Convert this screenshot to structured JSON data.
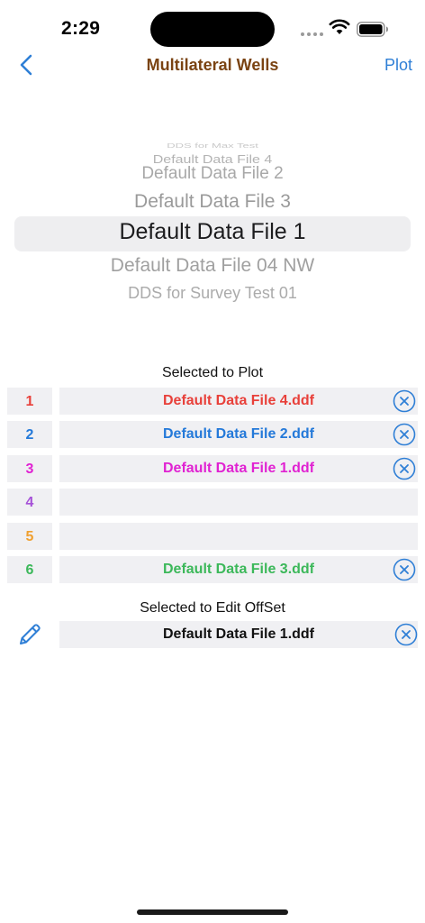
{
  "status_bar": {
    "time": "2:29"
  },
  "nav": {
    "back_icon": "chevron-left-icon",
    "title": "Multilateral Wells",
    "plot_label": "Plot",
    "title_color": "#7a4312",
    "accent_color": "#2f7fd6"
  },
  "picker": {
    "items": [
      "DDS for Max Test",
      "Default Data File 4",
      "Default Data File 2",
      "Default Data File 3",
      "Default Data File 1",
      "Default Data File 04 NW",
      "DDS for Survey Test 01"
    ],
    "selected": "Default Data File 1"
  },
  "selected_to_plot": {
    "header": "Selected to Plot",
    "rows": [
      {
        "number": "1",
        "file": "Default Data File 4.ddf",
        "color": "#e8403a",
        "has_clear": true
      },
      {
        "number": "2",
        "file": "Default Data File 2.ddf",
        "color": "#2479d9",
        "has_clear": true
      },
      {
        "number": "3",
        "file": "Default Data File 1.ddf",
        "color": "#e022d2",
        "has_clear": true
      },
      {
        "number": "4",
        "file": "",
        "color": "#a652d8",
        "has_clear": false
      },
      {
        "number": "5",
        "file": "",
        "color": "#f0a030",
        "has_clear": false
      },
      {
        "number": "6",
        "file": "Default Data File 3.ddf",
        "color": "#3cb85a",
        "has_clear": true
      }
    ]
  },
  "selected_to_edit": {
    "header": "Selected to Edit OffSet",
    "file": "Default Data File 1.ddf",
    "edit_icon": "pencil-icon",
    "clear_icon": "clear-circle-icon"
  }
}
